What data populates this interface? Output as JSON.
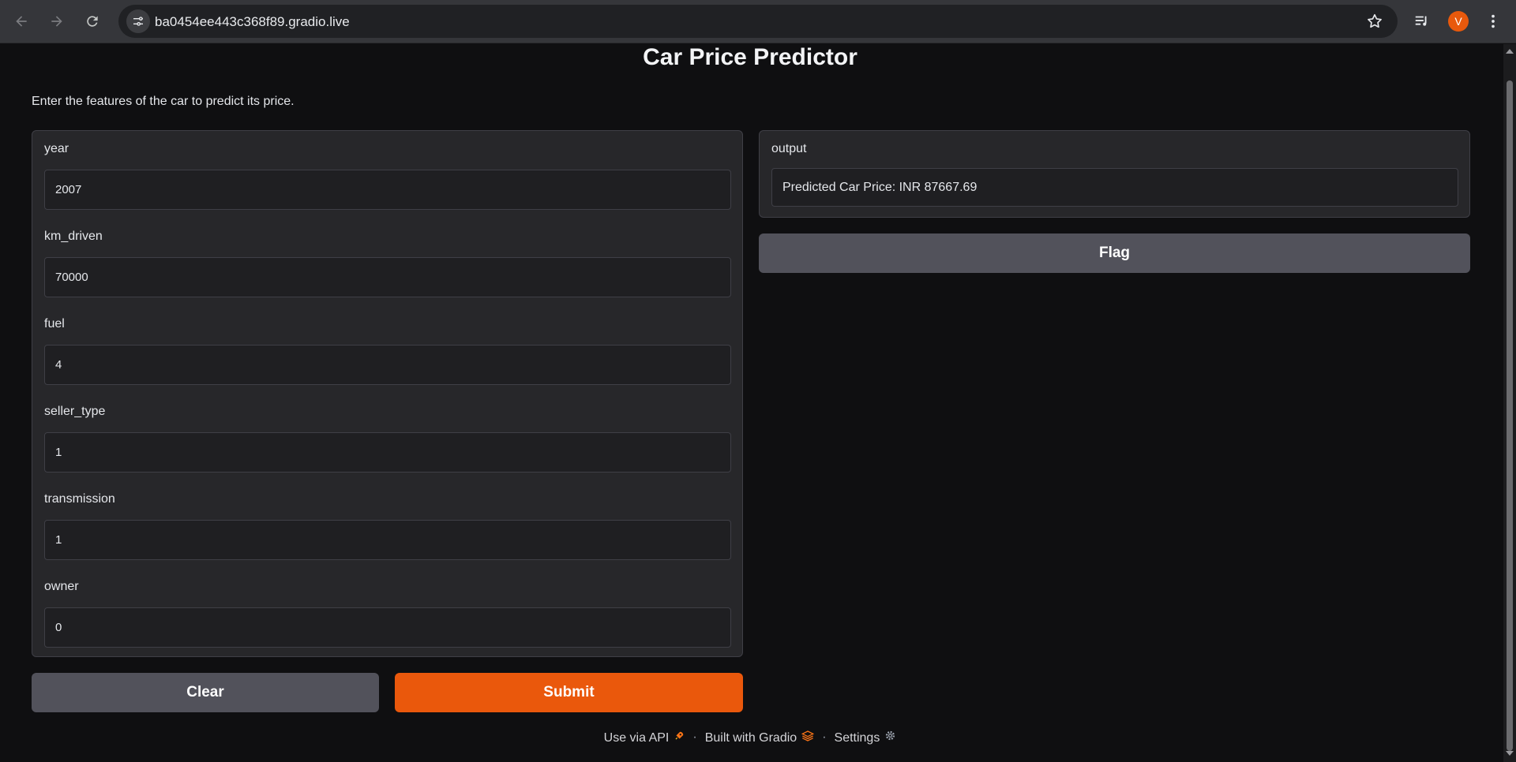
{
  "browser": {
    "url": "ba0454ee443c368f89.gradio.live",
    "avatar_letter": "V"
  },
  "app": {
    "title": "Car Price Predictor",
    "description": "Enter the features of the car to predict its price."
  },
  "inputs": [
    {
      "label": "year",
      "value": "2007"
    },
    {
      "label": "km_driven",
      "value": "70000"
    },
    {
      "label": "fuel",
      "value": "4"
    },
    {
      "label": "seller_type",
      "value": "1"
    },
    {
      "label": "transmission",
      "value": "1"
    },
    {
      "label": "owner",
      "value": "0"
    }
  ],
  "output": {
    "label": "output",
    "value": "Predicted Car Price: INR 87667.69"
  },
  "buttons": {
    "clear": "Clear",
    "submit": "Submit",
    "flag": "Flag"
  },
  "footer": {
    "api": "Use via API",
    "built": "Built with Gradio",
    "settings": "Settings",
    "separator": "·"
  },
  "colors": {
    "accent": "#ea580c",
    "background": "#0f0f11",
    "panel": "#27272a"
  }
}
